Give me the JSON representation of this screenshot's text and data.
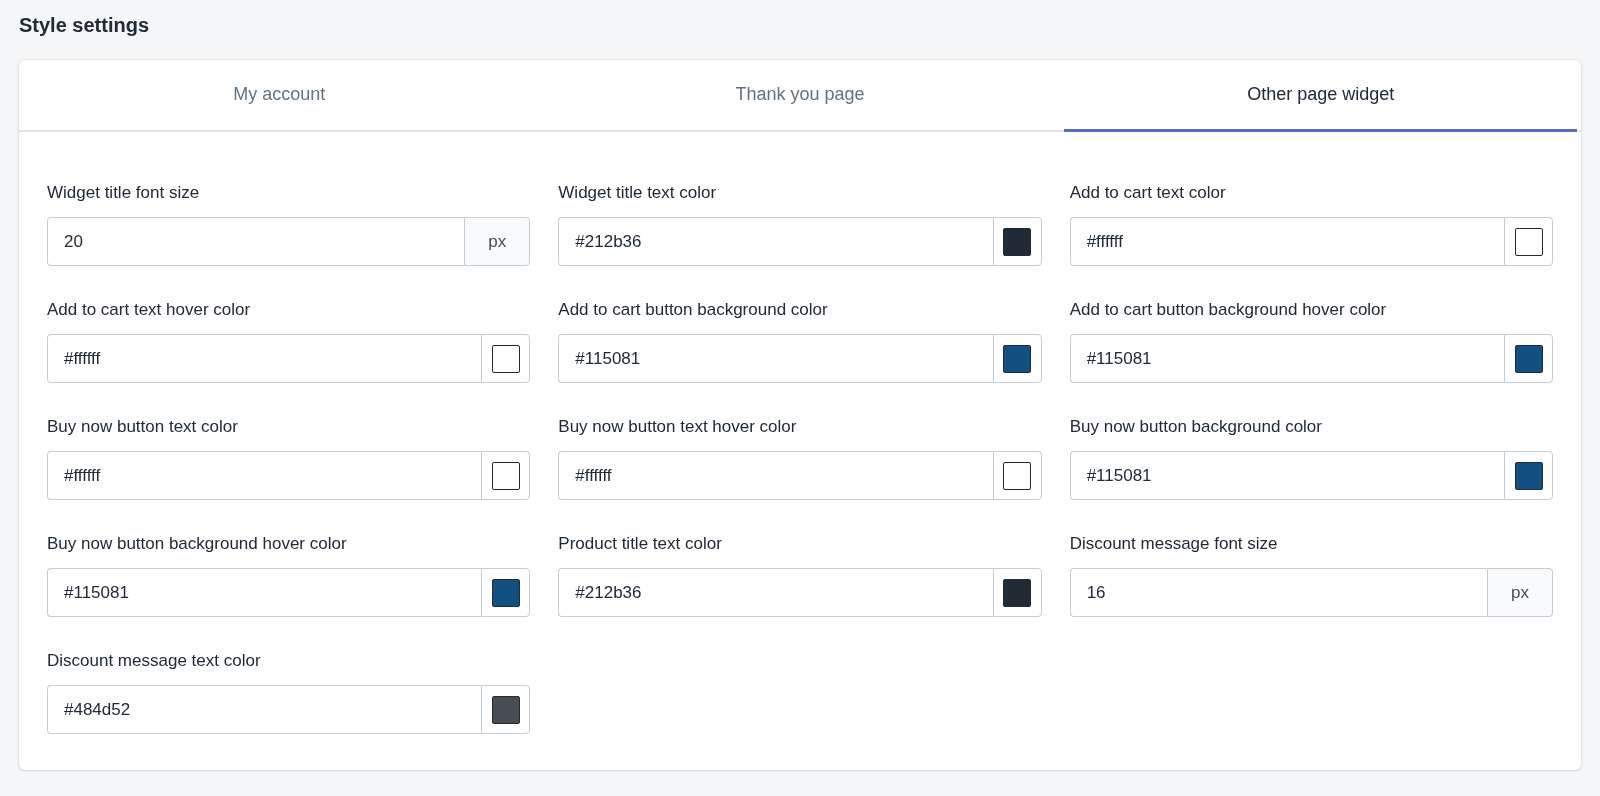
{
  "title": "Style settings",
  "tabs": [
    {
      "label": "My account",
      "selected": false
    },
    {
      "label": "Thank you page",
      "selected": false
    },
    {
      "label": "Other page widget",
      "selected": true
    }
  ],
  "fields": [
    {
      "kind": "unit",
      "label": "Widget title font size",
      "value": "20",
      "unit": "px"
    },
    {
      "kind": "color",
      "label": "Widget title text color",
      "value": "#212b36",
      "color": "#212b36"
    },
    {
      "kind": "color",
      "label": "Add to cart text color",
      "value": "#ffffff",
      "color": "#ffffff"
    },
    {
      "kind": "color",
      "label": "Add to cart text hover color",
      "value": "#ffffff",
      "color": "#ffffff"
    },
    {
      "kind": "color",
      "label": "Add to cart button background color",
      "value": "#115081",
      "color": "#115081"
    },
    {
      "kind": "color",
      "label": "Add to cart button background hover color",
      "value": "#115081",
      "color": "#115081"
    },
    {
      "kind": "color",
      "label": "Buy now button text color",
      "value": "#ffffff",
      "color": "#ffffff"
    },
    {
      "kind": "color",
      "label": "Buy now button text hover color",
      "value": "#ffffff",
      "color": "#ffffff"
    },
    {
      "kind": "color",
      "label": "Buy now button background color",
      "value": "#115081",
      "color": "#115081"
    },
    {
      "kind": "color",
      "label": "Buy now button background hover color",
      "value": "#115081",
      "color": "#115081"
    },
    {
      "kind": "color",
      "label": "Product title text color",
      "value": "#212b36",
      "color": "#212b36"
    },
    {
      "kind": "unit",
      "label": "Discount message font size",
      "value": "16",
      "unit": "px"
    },
    {
      "kind": "color",
      "label": "Discount message text color",
      "value": "#484d52",
      "color": "#484d52"
    }
  ]
}
